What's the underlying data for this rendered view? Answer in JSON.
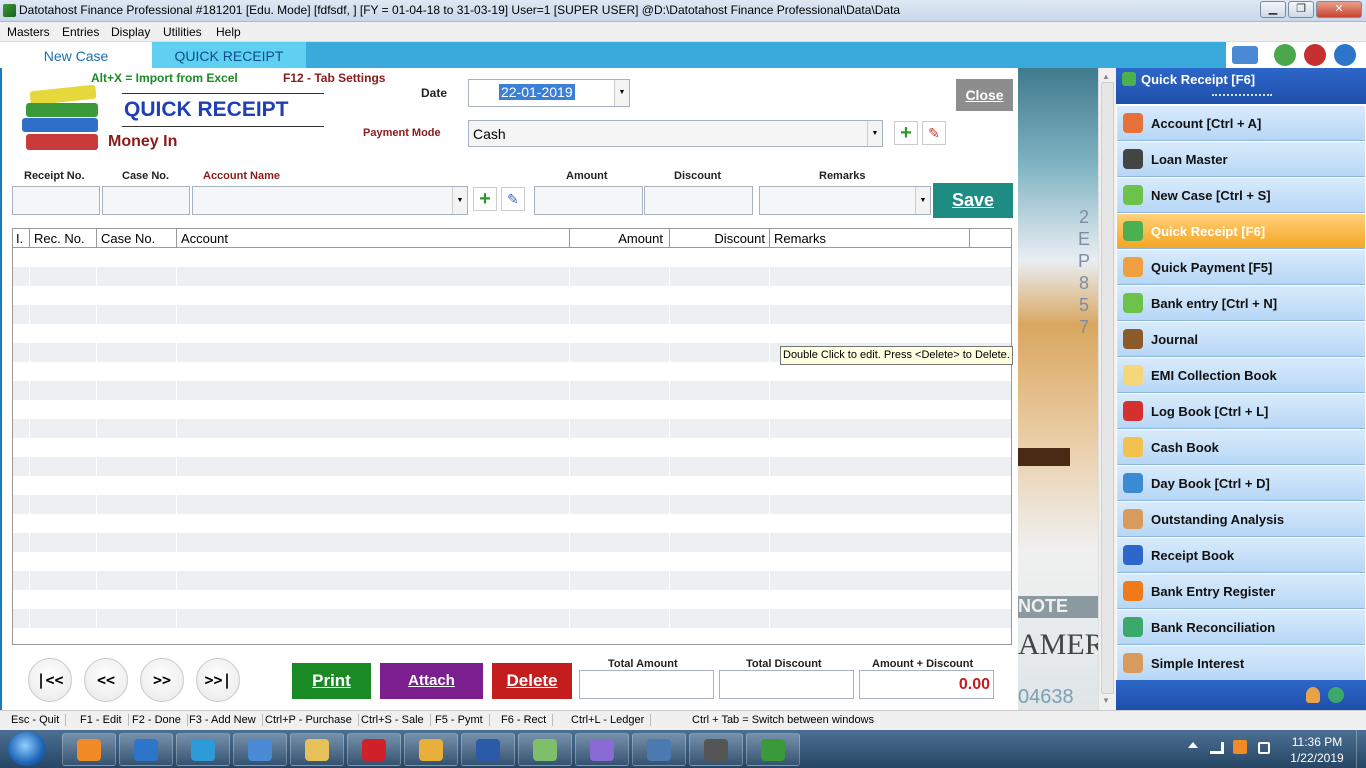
{
  "window": {
    "title": "Datotahost Finance Professional #181201  [Edu. Mode]  [fdfsdf, ] [FY = 01-04-18 to 31-03-19] User=1 [SUPER USER]  @D:\\Datotahost Finance Professional\\Data\\Data",
    "minimize": "▁",
    "maximize": "❐",
    "close": "✕"
  },
  "menu": [
    "Masters",
    "Entries",
    "Display",
    "Utilities",
    "Help"
  ],
  "tabs": {
    "new_case": "New Case",
    "quick_receipt": "QUICK RECEIPT"
  },
  "form": {
    "shortcut_import": "Alt+X =  Import from Excel",
    "shortcut_tab": "F12 - Tab Settings",
    "heading": "QUICK RECEIPT",
    "subheading": "Money In",
    "date_label": "Date",
    "date_value": "22-01-2019",
    "payment_mode_label": "Payment Mode",
    "payment_mode_value": "Cash",
    "close_label": "Close",
    "receipt_no_label": "Receipt No.",
    "case_no_label": "Case No.",
    "account_name_label": "Account Name",
    "amount_label": "Amount",
    "discount_label": "Discount",
    "remarks_label": "Remarks",
    "save_label": "Save"
  },
  "grid": {
    "columns": [
      "I.",
      "Rec. No.",
      "Case No.",
      "Account",
      "Amount",
      "Discount",
      "Remarks"
    ],
    "rows": [],
    "tooltip": "Double Click to edit.  Press <Delete> to Delete."
  },
  "footer": {
    "nav_first": "|<<",
    "nav_prev": "<<",
    "nav_next": ">>",
    "nav_last": ">>|",
    "print": "Print",
    "attach": "Attach",
    "delete": "Delete",
    "total_amount_label": "Total Amount",
    "total_discount_label": "Total Discount",
    "amount_discount_label": "Amount + Discount",
    "amount_discount_value": "0.00"
  },
  "sidebar": {
    "header": "Quick Receipt [F6]",
    "items": [
      {
        "label": "Account [Ctrl + A]",
        "icon": "account-icon",
        "color": "#e8703a"
      },
      {
        "label": "Loan Master",
        "icon": "film-reel-icon",
        "color": "#444444"
      },
      {
        "label": "New Case [Ctrl + S]",
        "icon": "cylinder-icon",
        "color": "#6cc24a"
      },
      {
        "label": "Quick Receipt [F6]",
        "icon": "receipt-icon",
        "color": "#4caf50",
        "active": true
      },
      {
        "label": "Quick Payment [F5]",
        "icon": "payment-icon",
        "color": "#f0a040"
      },
      {
        "label": "Bank entry [Ctrl + N]",
        "icon": "bank-entry-icon",
        "color": "#6cc24a"
      },
      {
        "label": "Journal",
        "icon": "journal-icon",
        "color": "#8a5a2a"
      },
      {
        "label": "EMI Collection Book",
        "icon": "notebook-icon",
        "color": "#f5d77a"
      },
      {
        "label": "Log Book [Ctrl + L]",
        "icon": "user-icon",
        "color": "#d43030"
      },
      {
        "label": "Cash Book",
        "icon": "magnifier-icon",
        "color": "#f2c14e"
      },
      {
        "label": "Day Book [Ctrl + D]",
        "icon": "daybook-icon",
        "color": "#3a8ad4"
      },
      {
        "label": "Outstanding Analysis",
        "icon": "book-icon",
        "color": "#d89b5b"
      },
      {
        "label": "Receipt Book",
        "icon": "search-user-icon",
        "color": "#2d67c9"
      },
      {
        "label": "Bank Entry Register",
        "icon": "cone-icon",
        "color": "#f07a1a"
      },
      {
        "label": "Bank Reconciliation",
        "icon": "globe-icon",
        "color": "#3aa96b"
      },
      {
        "label": "Simple Interest",
        "icon": "book-icon",
        "color": "#d89b5b"
      }
    ]
  },
  "statusbar": [
    "Esc - Quit",
    "F1 - Edit",
    "F2 - Done",
    "F3 - Add New",
    "Ctrl+P - Purchase",
    "Ctrl+S - Sale",
    "F5 - Pymt",
    "F6 - Rect",
    "Ctrl+L - Ledger",
    "Ctrl + Tab = Switch between windows"
  ],
  "taskbar": {
    "time": "11:36 PM",
    "date": "1/22/2019",
    "apps": [
      "vlc-icon",
      "snipping-icon",
      "ie-icon",
      "control-panel-icon",
      "explorer-icon",
      "opera-icon",
      "chrome-icon",
      "word-icon",
      "notes-icon",
      "paint-icon",
      "magnifier-icon",
      "media-icon",
      "finance-icon"
    ]
  },
  "colors": {
    "accent": "#3aa9dc",
    "save": "#1f8c83",
    "print": "#1a8a25",
    "attach": "#7b1f8e",
    "delete": "#c41d1d",
    "heading": "#1f3fb4",
    "subheading": "#8b1a1a"
  }
}
